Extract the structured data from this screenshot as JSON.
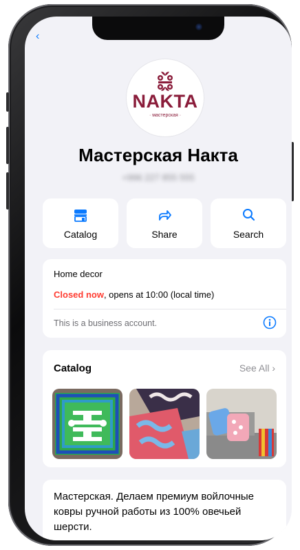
{
  "business": {
    "logo_word": "NAKTA",
    "logo_sub": "· мастерская ·",
    "name": "Мастерская Накта",
    "phone_blurred": "+996 227 855 555"
  },
  "actions": [
    {
      "label": "Catalog",
      "icon": "storefront-icon"
    },
    {
      "label": "Share",
      "icon": "share-arrow-icon"
    },
    {
      "label": "Search",
      "icon": "search-icon"
    }
  ],
  "info": {
    "category": "Home decor",
    "closed_label": "Closed now",
    "hours_rest": ", opens at 10:00 (local time)",
    "note": "This is a business account.",
    "note_icon": "info-icon"
  },
  "catalog": {
    "title": "Catalog",
    "see_all": "See All",
    "items": [
      {
        "image": "green felt carpet with white ornament"
      },
      {
        "image": "red and blue felt carpets with ornaments"
      },
      {
        "image": "decorative felt pillows on sofa"
      }
    ]
  },
  "description": "Мастерская. Делаем премиум войлочные ковры ручной работы из 100% овечьей шерсти.",
  "colors": {
    "accent": "#0a7aff",
    "closed": "#ff3b30",
    "brand": "#8a1c3a"
  }
}
